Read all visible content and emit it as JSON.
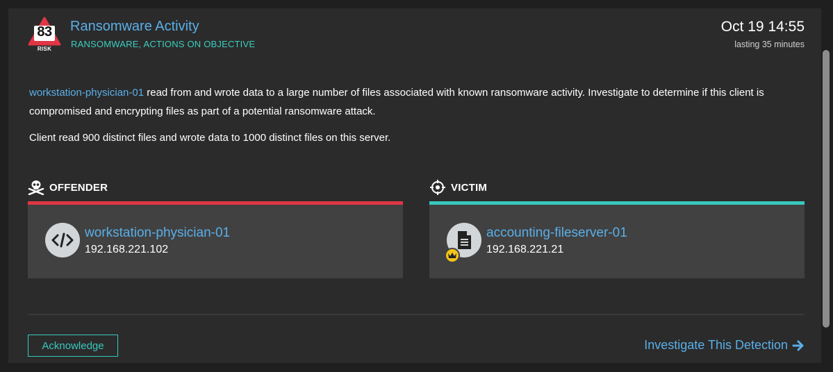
{
  "detection": {
    "risk_score": "83",
    "risk_label": "RISK",
    "title": "Ransomware Activity",
    "categories": "RANSOMWARE, ACTIONS ON OBJECTIVE",
    "time": "Oct 19 14:55",
    "duration": "lasting 35 minutes"
  },
  "description": {
    "link_text": "workstation-physician-01",
    "text": " read from and wrote data to a large number of files associated with known ransomware activity. Investigate to determine if this client is compromised and encrypting files as part of a potential ransomware attack.",
    "detail": "Client read 900 distinct files and wrote data to 1000 distinct files on this server."
  },
  "offender": {
    "heading": "OFFENDER",
    "heading_icon": "skull-crossbones-icon",
    "device_icon": "code-icon",
    "name": "workstation-physician-01",
    "ip": "192.168.221.102",
    "accent": "#e03645"
  },
  "victim": {
    "heading": "VICTIM",
    "heading_icon": "crosshair-icon",
    "device_icon": "file-server-icon",
    "badge_icon": "crown-icon",
    "name": "accounting-fileserver-01",
    "ip": "192.168.221.21",
    "accent": "#38c9bd"
  },
  "actions": {
    "acknowledge_label": "Acknowledge",
    "investigate_label": "Investigate This Detection",
    "investigate_icon": "arrow-right-icon"
  },
  "colors": {
    "link": "#5aafe8",
    "teal": "#3ccfbf",
    "risk_red": "#e03645"
  }
}
